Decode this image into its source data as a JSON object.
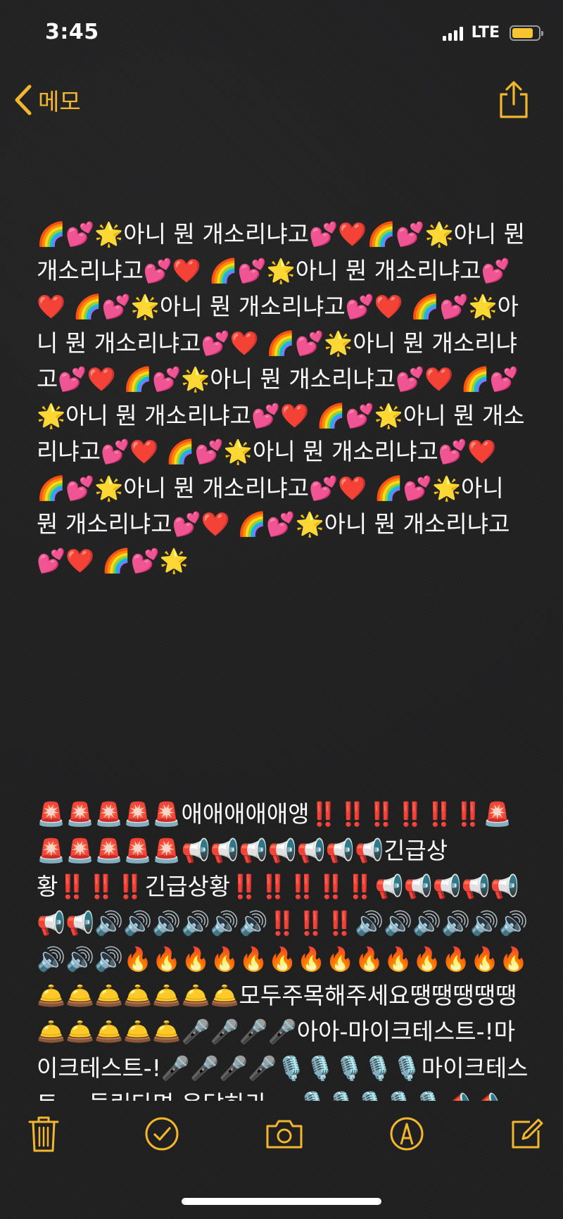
{
  "status": {
    "time": "3:45",
    "network": "LTE",
    "battery_level": 0.8
  },
  "nav": {
    "back_label": "메모",
    "back_icon": "chevron-left-icon",
    "share_icon": "share-icon"
  },
  "note": {
    "paragraph_1": "🌈💕🌟아니 뭔 개소리냐고💕❤️🌈💕🌟아니 뭔 개소리냐고💕❤️ 🌈💕🌟아니 뭔 개소리냐고💕❤️ 🌈💕🌟아니 뭔 개소리냐고💕❤️ 🌈💕🌟아니 뭔 개소리냐고💕❤️ 🌈💕🌟아니 뭔 개소리냐고💕❤️ 🌈💕🌟아니 뭔 개소리냐고💕❤️ 🌈💕🌟아니 뭔 개소리냐고💕❤️ 🌈💕🌟아니 뭔 개소리냐고💕❤️ 🌈💕🌟아니 뭔 개소리냐고💕❤️ 🌈💕🌟아니 뭔 개소리냐고💕❤️ 🌈💕🌟아니 뭔 개소리냐고💕❤️ 🌈💕🌟아니 뭔 개소리냐고💕❤️ 🌈💕🌟",
    "paragraph_2": "🚨🚨🚨🚨🚨애애애애애앵‼️‼️‼️‼️‼️‼️🚨🚨🚨🚨🚨🚨📢📢📢📢📢📢📢긴급상황‼️‼️‼️긴급상황‼️‼️‼️‼️‼️📢📢📢📢📢📢📢🔊🔊🔊🔊🔊🔊‼️‼️‼️🔊🔊🔊🔊🔊🔊🔊🔊🔊🔥🔥🔥🔥🔥🔥🔥🔥🔥🔥🔥🔥🔥🔥🛎️🛎️🛎️🛎️🛎️🛎️🛎️모두주목해주세요땡땡땡땡땡🛎️🛎️🛎️🛎️🛎️🎤🎤🎤🎤아아-마이크테스트-!마이크테스트-!🎤🎤🎤🎤🎙️🎙️🎙️🎙️🎙️마이크테스트— 들린다면 응답하라—-🎙️🎙️🎙️🎙️🎙️📣📣📣📣📣📣📣"
  },
  "toolbar": {
    "delete_icon": "trash-icon",
    "checklist_icon": "checkmark-circle-icon",
    "camera_icon": "camera-icon",
    "markup_icon": "markup-pen-icon",
    "compose_icon": "compose-icon"
  },
  "colors": {
    "accent": "#f2b72c",
    "background": "#1f1f20",
    "text": "#ffffff",
    "battery": "#f7c531"
  }
}
